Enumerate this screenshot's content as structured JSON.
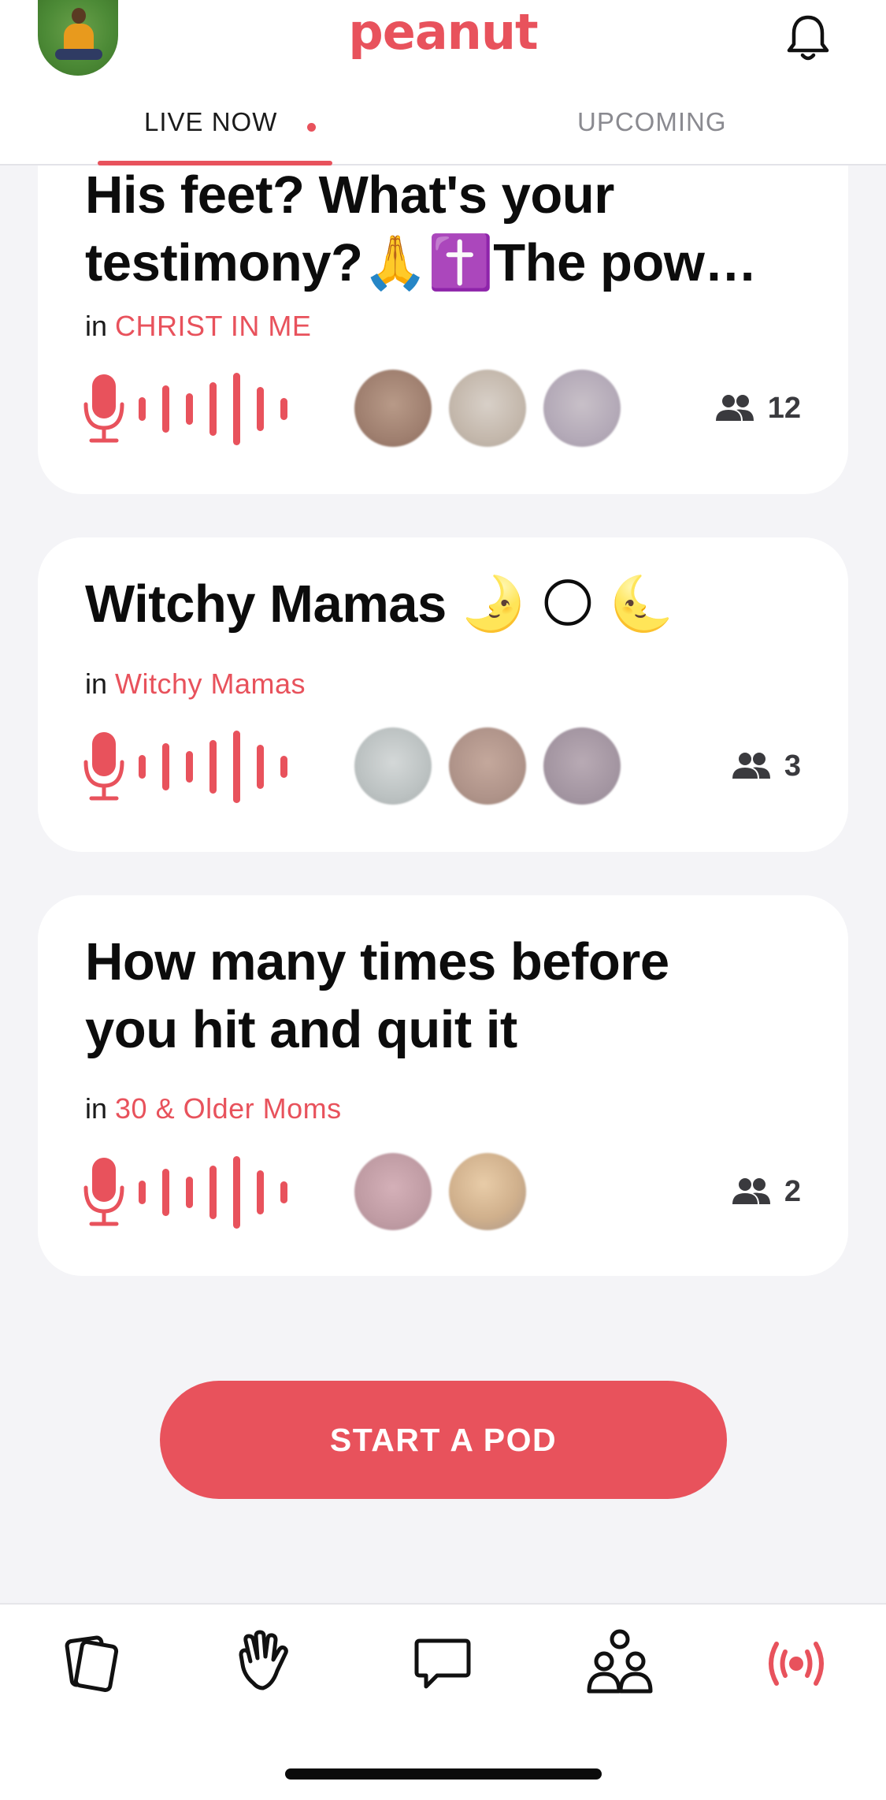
{
  "header": {
    "logo": "peanut",
    "tabs": [
      {
        "label": "LIVE NOW",
        "active": true,
        "live_indicator": true
      },
      {
        "label": "UPCOMING",
        "active": false
      }
    ]
  },
  "pods": [
    {
      "title_lines": [
        "His feet? What's your",
        "testimony?🙏✝️The pow…"
      ],
      "group_prefix": "in",
      "group": "CHRIST IN ME",
      "participant_count": "12",
      "avatars": 3
    },
    {
      "title_lines": [
        "Witchy Mamas 🌛 🌕 🌜"
      ],
      "group_prefix": "in",
      "group": "Witchy Mamas",
      "participant_count": "3",
      "avatars": 3
    },
    {
      "title_lines": [
        "How many times before",
        "you hit and quit it"
      ],
      "group_prefix": "in",
      "group": "30 & Older Moms",
      "participant_count": "2",
      "avatars": 2
    }
  ],
  "start_button": {
    "label": "START A POD"
  },
  "bottom_nav": {
    "items": [
      {
        "icon": "cards-icon",
        "active": false
      },
      {
        "icon": "wave-hand-icon",
        "active": false
      },
      {
        "icon": "chat-icon",
        "active": false
      },
      {
        "icon": "community-icon",
        "active": false
      },
      {
        "icon": "live-broadcast-icon",
        "active": true
      }
    ]
  },
  "colors": {
    "accent": "#e8525c",
    "background": "#f4f4f7",
    "card": "#ffffff"
  }
}
